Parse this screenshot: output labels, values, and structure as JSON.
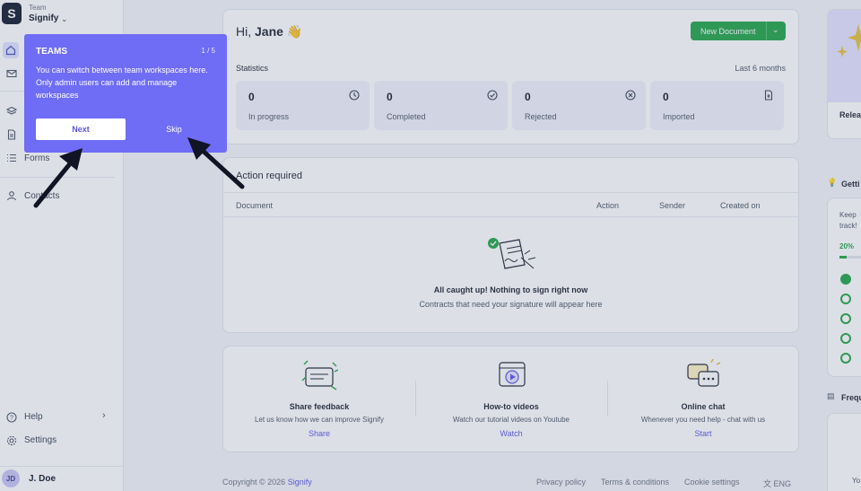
{
  "team": {
    "logo_letter": "S",
    "label": "Team",
    "name": "Signify"
  },
  "sidebar": {
    "forms_label": "Forms",
    "contacts_label": "Contacts",
    "help_label": "Help",
    "settings_label": "Settings",
    "user": {
      "initials": "JD",
      "name": "J. Doe"
    }
  },
  "header": {
    "greeting_prefix": "Hi,",
    "user_first_name": "Jane",
    "wave_emoji": "👋",
    "new_document_label": "New Document"
  },
  "stats": {
    "title": "Statistics",
    "period": "Last 6 months",
    "items": [
      {
        "value": "0",
        "label": "In progress",
        "icon": "clock-icon"
      },
      {
        "value": "0",
        "label": "Completed",
        "icon": "check-circle-icon"
      },
      {
        "value": "0",
        "label": "Rejected",
        "icon": "x-circle-icon"
      },
      {
        "value": "0",
        "label": "Imported",
        "icon": "file-import-icon"
      }
    ]
  },
  "action_required": {
    "title": "Action required",
    "columns": [
      "Document",
      "Action",
      "Sender",
      "Created on"
    ],
    "empty_title": "All caught up! Nothing to sign right now",
    "empty_subtitle": "Contracts that need your signature will appear here"
  },
  "help_cards": [
    {
      "title": "Share feedback",
      "subtitle": "Let us know how we can improve Signify",
      "link": "Share"
    },
    {
      "title": "How-to videos",
      "subtitle": "Watch our tutorial videos on Youtube",
      "link": "Watch"
    },
    {
      "title": "Online chat",
      "subtitle": "Whenever you need help - chat with us",
      "link": "Start"
    }
  ],
  "footer": {
    "copyright": "Copyright © 2026",
    "brand": "Signify",
    "privacy": "Privacy policy",
    "terms": "Terms & conditions",
    "cookies": "Cookie settings",
    "language": "ENG"
  },
  "right_rail": {
    "release_label": "Relea",
    "getting_title": "Getti",
    "getting_text_1": "Keep",
    "getting_text_2": "track!",
    "progress_pct": "20%",
    "progress_value": 0.2,
    "faq_title": "Frequ",
    "faq_text": "Yo"
  },
  "tour": {
    "title": "TEAMS",
    "step": "1 / 5",
    "body": "You can switch between team workspaces here. Only admin users can add and manage workspaces",
    "next_label": "Next",
    "skip_label": "Skip"
  },
  "colors": {
    "accent": "#6f6cf5",
    "success": "#22a447",
    "brand_dark": "#141a2e",
    "link": "#5b55e6"
  }
}
